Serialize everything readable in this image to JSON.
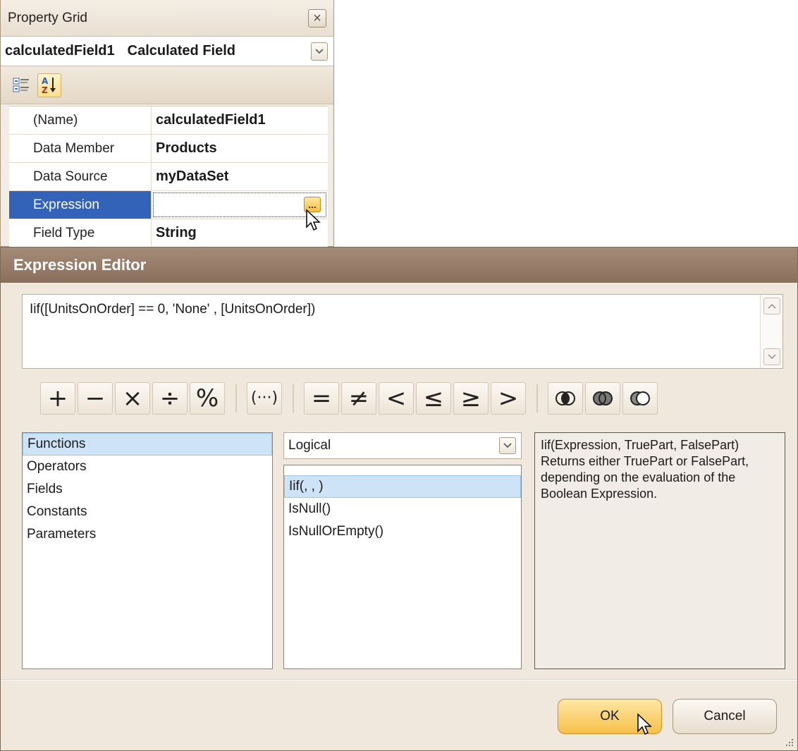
{
  "property_grid": {
    "title": "Property Grid",
    "selected_object": {
      "name": "calculatedField1",
      "type": "Calculated Field"
    },
    "rows": [
      {
        "key": "(Name)",
        "value": "calculatedField1"
      },
      {
        "key": "Data Member",
        "value": "Products"
      },
      {
        "key": "Data Source",
        "value": "myDataSet"
      },
      {
        "key": "Expression",
        "value": ""
      },
      {
        "key": "Field Type",
        "value": "String"
      }
    ],
    "ellipsis_label": "..."
  },
  "expression_editor": {
    "title": "Expression Editor",
    "expression": "Iif([UnitsOnOrder] == 0, 'None' , [UnitsOnOrder])",
    "operators": {
      "arithmetic": [
        "+",
        "−",
        "×",
        "÷",
        "%"
      ],
      "grouping": "(···)",
      "comparison": [
        "=",
        "≠",
        "<",
        "≤",
        "≥",
        ">"
      ]
    },
    "categories": [
      "Functions",
      "Operators",
      "Fields",
      "Constants",
      "Parameters"
    ],
    "function_group": "Logical",
    "functions": [
      "Iif(, , )",
      "IsNull()",
      "IsNullOrEmpty()"
    ],
    "description": "Iif(Expression, TruePart, FalsePart)\nReturns either TruePart or FalsePart, depending on the evaluation of the Boolean Expression.",
    "buttons": {
      "ok": "OK",
      "cancel": "Cancel"
    }
  }
}
